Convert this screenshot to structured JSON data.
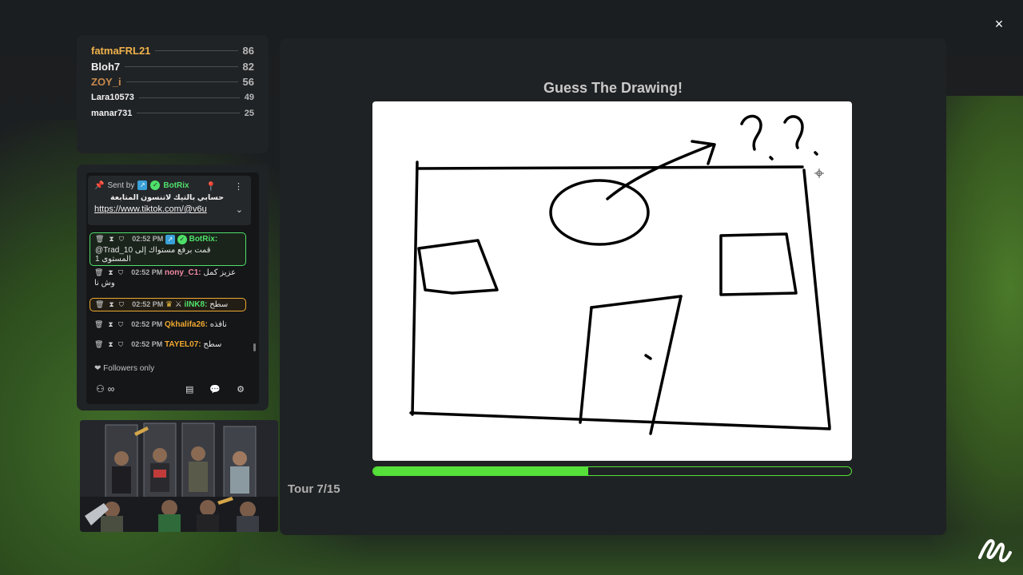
{
  "window": {
    "close_label": "×"
  },
  "leaderboard": {
    "rows": [
      {
        "name": "fatmaFRL21",
        "score": "86",
        "color": "#f0b24a"
      },
      {
        "name": "Bloh7",
        "score": "82",
        "color": "#f2f2f2"
      },
      {
        "name": "ZOY_i",
        "score": "56",
        "color": "#c98a4e"
      },
      {
        "name": "Lara10573",
        "score": "49",
        "color": "#f2f2f2"
      },
      {
        "name": "manar731",
        "score": "25",
        "color": "#f2f2f2"
      }
    ]
  },
  "chat": {
    "pinned": {
      "sent_by": "Sent by",
      "sender": "BotRix",
      "text": "حسابي بالتيك لاتنسون المتابعة",
      "link": "https://www.tiktok.com/@v6u"
    },
    "messages": [
      {
        "time": "02:52 PM",
        "user": "BotRix:",
        "text": "@Trad_10 قمت برفع مستواك إلى المستوى 1"
      },
      {
        "time": "02:52 PM",
        "user": "nony_C1:",
        "text": "عزيز كمل",
        "text2": "وش نا"
      },
      {
        "time": "02:52 PM",
        "user": "iINK8:",
        "text": "سطح"
      },
      {
        "time": "02:52 PM",
        "user": "Qkhalifa26:",
        "text": "نافذه"
      },
      {
        "time": "02:52 PM",
        "user": "TAYEL07:",
        "text": "سطح"
      }
    ],
    "followers_only": "Followers only",
    "infinity_symbol": "∞"
  },
  "game": {
    "title": "Guess The Drawing!",
    "progress": 0.45,
    "tour": "Tour 7/15"
  },
  "colors": {
    "accent_green": "#55e03a",
    "gold": "#f0b24a"
  },
  "icons": [
    "close-icon",
    "pin-icon",
    "more-icon",
    "chevron-down-icon",
    "trash-icon",
    "timeout-icon",
    "shield-icon",
    "heart-icon",
    "users-icon",
    "list-icon",
    "chat-icon",
    "gear-icon",
    "brand-logo-icon"
  ]
}
